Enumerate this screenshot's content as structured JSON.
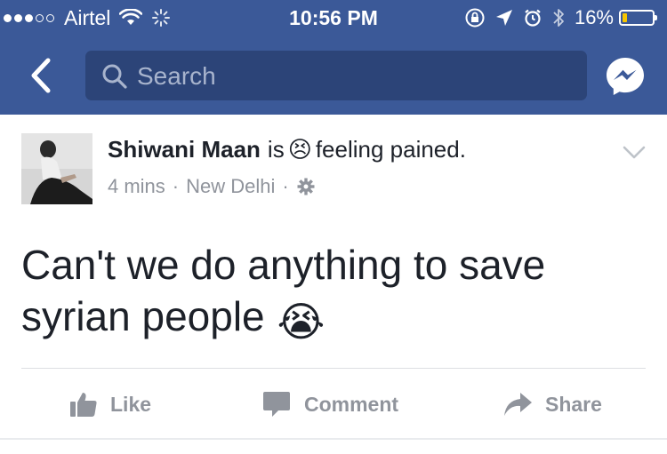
{
  "status_bar": {
    "carrier": "Airtel",
    "time": "10:56 PM",
    "battery_percent": "16%",
    "battery_level": 0.16,
    "icons": [
      "signal-dots",
      "wifi-icon",
      "activity-spinner-icon",
      "rotation-lock-icon",
      "location-arrow-icon",
      "alarm-icon",
      "bluetooth-icon",
      "battery-icon"
    ]
  },
  "nav": {
    "back_icon": "chevron-left-icon",
    "search_placeholder": "Search",
    "messenger_icon": "messenger-icon"
  },
  "post": {
    "author": "Shiwani Maan",
    "is_word": "is",
    "feeling": "feeling pained.",
    "feeling_emoji": "😣",
    "time_ago": "4 mins",
    "separator": "·",
    "location": "New Delhi",
    "privacy_icon": "gear-icon",
    "menu_icon": "chevron-down-icon",
    "text_line1": "Can't we do anything to save",
    "text_line2": "syrian people",
    "text_emoji": "😭"
  },
  "actions": {
    "like": "Like",
    "comment": "Comment",
    "share": "Share"
  },
  "colors": {
    "brand": "#3b5998",
    "search_bg": "#2c4478",
    "muted": "#90949c",
    "text": "#1d2129"
  }
}
